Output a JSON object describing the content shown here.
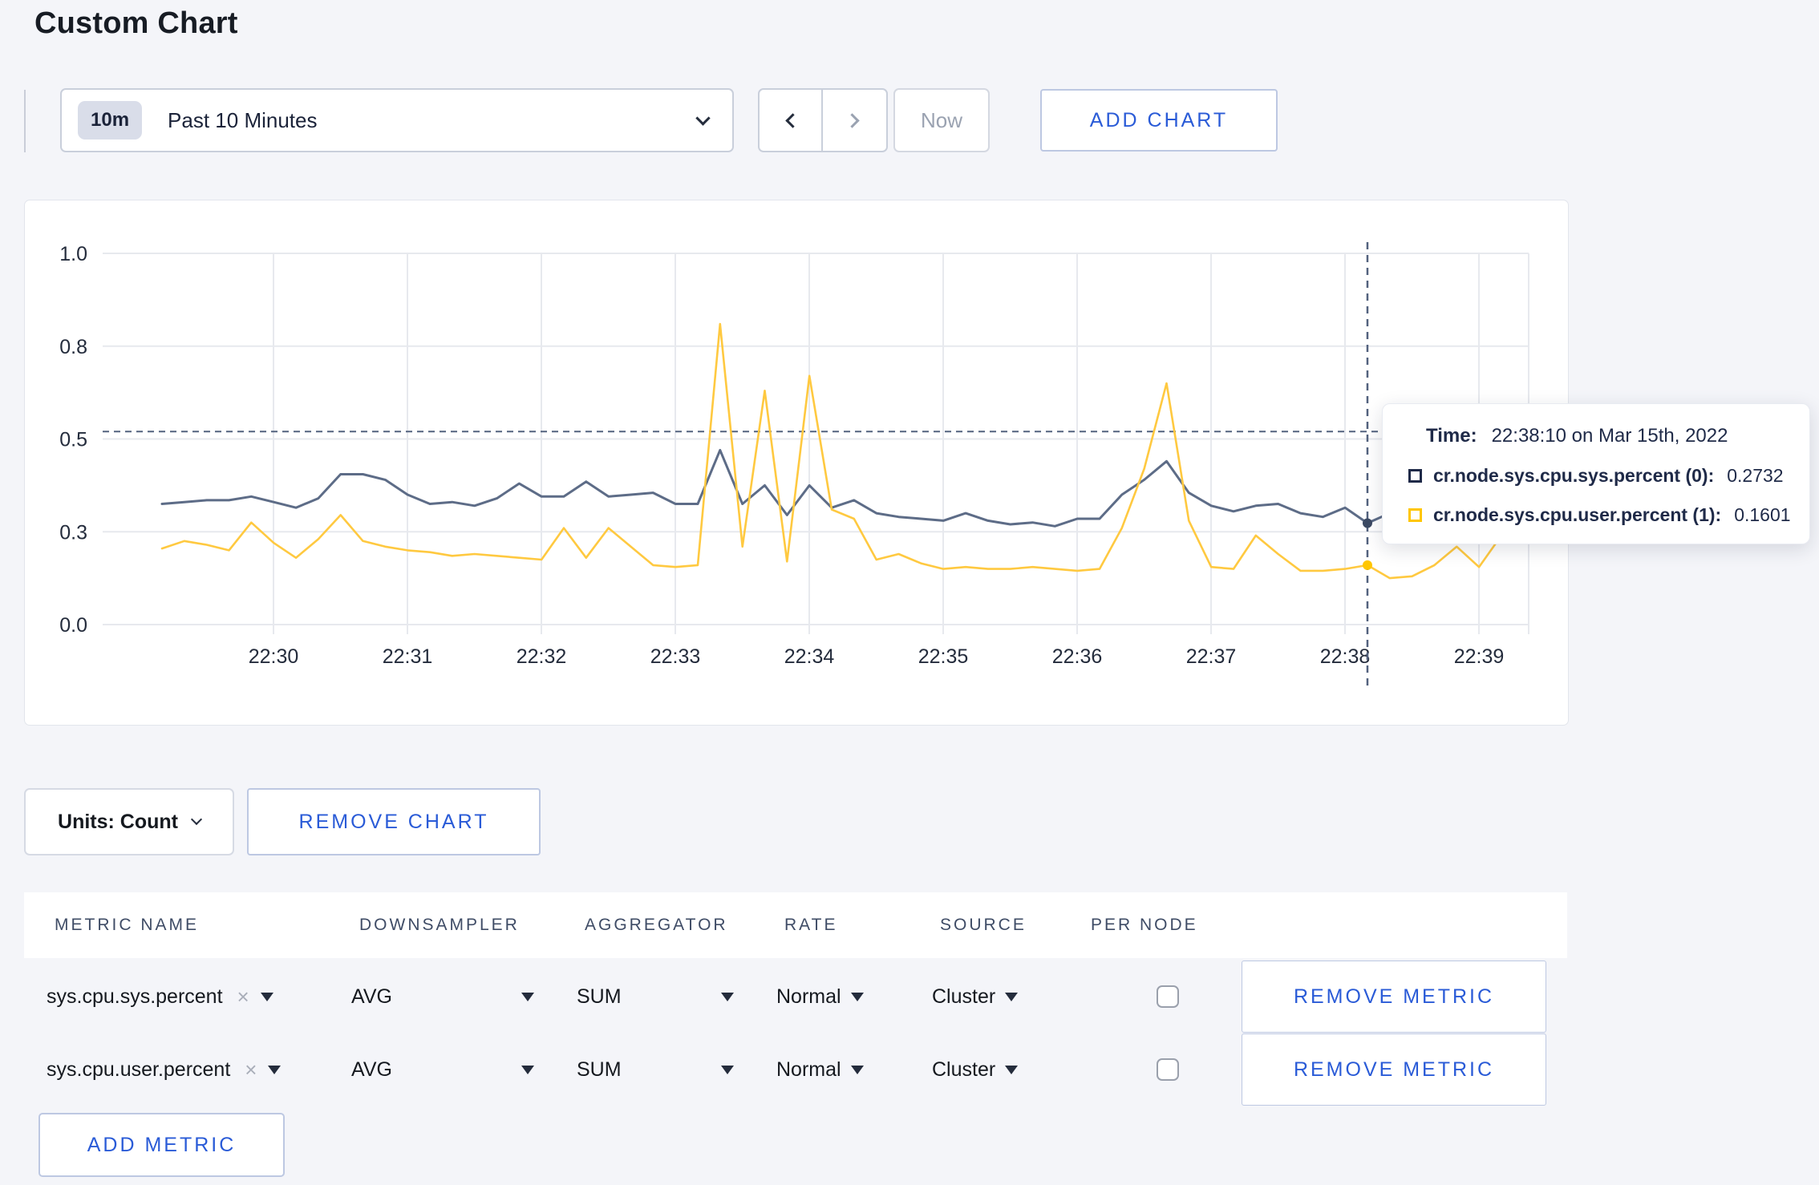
{
  "page": {
    "title": "Custom Chart"
  },
  "toolbar": {
    "time_window_badge": "10m",
    "time_window_label": "Past 10 Minutes",
    "now_label": "Now",
    "add_chart_label": "ADD CHART"
  },
  "tooltip": {
    "time_label": "Time:",
    "time_value": "22:38:10 on Mar 15th, 2022",
    "series": [
      {
        "label": "cr.node.sys.cpu.sys.percent (0):",
        "value": "0.2732",
        "swatch_color": "#1f2a48"
      },
      {
        "label": "cr.node.sys.cpu.user.percent (1):",
        "value": "0.1601",
        "swatch_color": "#ffc600"
      }
    ]
  },
  "chart_data": {
    "type": "line",
    "title": "",
    "xlabel": "",
    "ylabel": "",
    "ylim": [
      0,
      1
    ],
    "grid": true,
    "legend_position": "tooltip",
    "x_start": "22:29:10",
    "x_end": "22:39:10",
    "sample_interval_seconds": 10,
    "x_tick_labels": [
      "22:30",
      "22:31",
      "22:32",
      "22:33",
      "22:34",
      "22:35",
      "22:36",
      "22:37",
      "22:38",
      "22:39"
    ],
    "y_ticks": [
      {
        "label": "0.0",
        "value": 0
      },
      {
        "label": "0.3",
        "value": 0.25
      },
      {
        "label": "0.5",
        "value": 0.5
      },
      {
        "label": "0.8",
        "value": 0.75
      },
      {
        "label": "1.0",
        "value": 1
      }
    ],
    "series": [
      {
        "name": "cr.node.sys.cpu.sys.percent",
        "color": "#5d6c87",
        "dot_color": "#3c4a63",
        "values": [
          0.325,
          0.33,
          0.335,
          0.335,
          0.345,
          0.33,
          0.315,
          0.34,
          0.405,
          0.405,
          0.39,
          0.35,
          0.325,
          0.33,
          0.32,
          0.34,
          0.38,
          0.345,
          0.345,
          0.385,
          0.345,
          0.35,
          0.355,
          0.325,
          0.325,
          0.47,
          0.325,
          0.375,
          0.295,
          0.375,
          0.315,
          0.335,
          0.3,
          0.29,
          0.285,
          0.28,
          0.3,
          0.28,
          0.27,
          0.275,
          0.265,
          0.285,
          0.285,
          0.35,
          0.39,
          0.44,
          0.355,
          0.32,
          0.305,
          0.32,
          0.325,
          0.3,
          0.29,
          0.315,
          0.2732,
          0.3,
          0.315,
          0.295,
          0.3,
          0.295,
          0.305
        ]
      },
      {
        "name": "cr.node.sys.cpu.user.percent",
        "color": "#ffc940",
        "dot_color": "#ffc600",
        "values": [
          0.205,
          0.225,
          0.215,
          0.2,
          0.275,
          0.22,
          0.18,
          0.23,
          0.295,
          0.225,
          0.21,
          0.2,
          0.195,
          0.185,
          0.19,
          0.185,
          0.18,
          0.175,
          0.26,
          0.18,
          0.26,
          0.21,
          0.16,
          0.155,
          0.16,
          0.81,
          0.21,
          0.63,
          0.17,
          0.67,
          0.31,
          0.285,
          0.175,
          0.19,
          0.165,
          0.15,
          0.155,
          0.15,
          0.15,
          0.155,
          0.15,
          0.145,
          0.15,
          0.26,
          0.42,
          0.65,
          0.28,
          0.155,
          0.15,
          0.24,
          0.19,
          0.145,
          0.145,
          0.15,
          0.1601,
          0.125,
          0.13,
          0.16,
          0.21,
          0.155,
          0.24
        ]
      }
    ],
    "crosshair": {
      "time": "22:38:10",
      "index": 54,
      "hline_value": 0.52
    }
  },
  "units_bar": {
    "units_label": "Units: Count",
    "remove_chart_label": "REMOVE CHART"
  },
  "metrics_table": {
    "headers": [
      "METRIC NAME",
      "DOWNSAMPLER",
      "AGGREGATOR",
      "RATE",
      "SOURCE",
      "PER NODE"
    ],
    "rows": [
      {
        "metric_name": "sys.cpu.sys.percent",
        "downsampler": "AVG",
        "aggregator": "SUM",
        "rate": "Normal",
        "source": "Cluster",
        "per_node_checked": false,
        "remove_label": "REMOVE METRIC"
      },
      {
        "metric_name": "sys.cpu.user.percent",
        "downsampler": "AVG",
        "aggregator": "SUM",
        "rate": "Normal",
        "source": "Cluster",
        "per_node_checked": false,
        "remove_label": "REMOVE METRIC"
      }
    ],
    "add_metric_label": "ADD METRIC"
  },
  "colors": {
    "accent_blue": "#2a5bd7",
    "page_bg": "#f4f5f9",
    "grid_line": "#e7e9ee",
    "crosshair": "#53627e",
    "tick_text": "#242c3c"
  }
}
